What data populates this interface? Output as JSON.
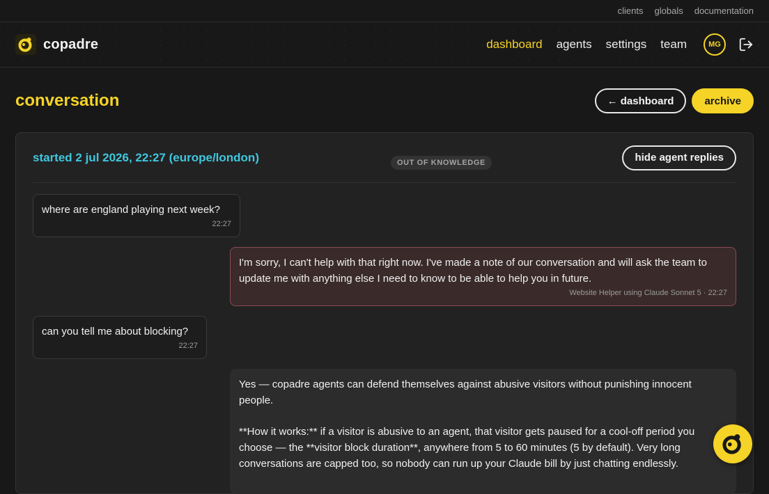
{
  "topbar": {
    "links": [
      "clients",
      "globals",
      "documentation"
    ]
  },
  "brand": {
    "name": "copadre",
    "accent": "#f5d327"
  },
  "nav": {
    "items": [
      {
        "label": "dashboard",
        "active": true
      },
      {
        "label": "agents",
        "active": false
      },
      {
        "label": "settings",
        "active": false
      },
      {
        "label": "team",
        "active": false
      }
    ],
    "avatar_initials": "MG",
    "logout_icon": "logout-icon"
  },
  "page": {
    "title": "conversation",
    "back_label": "← dashboard",
    "archive_label": "archive"
  },
  "conversation": {
    "started": "started 2 jul 2026, 22:27 (europe/london)",
    "status_badge": "OUT OF KNOWLEDGE",
    "hide_replies_label": "hide agent replies",
    "messages": [
      {
        "role": "user",
        "text": "where are england playing next week?",
        "time": "22:27"
      },
      {
        "role": "agent",
        "text": "I'm sorry, I can't help with that right now. I've made a note of our conversation and will ask the team to update me with anything else I need to know to be able to help you in future.",
        "meta": "Website Helper using Claude Sonnet 5 · 22:27"
      },
      {
        "role": "user",
        "text": "can you tell me about blocking?",
        "time": "22:27"
      },
      {
        "role": "agent",
        "paragraphs": [
          "Yes — copadre agents can defend themselves against abusive visitors without punishing innocent people.",
          "**How it works:** if a visitor is abusive to an agent, that visitor gets paused for a cool-off period you choose — the **visitor block duration**, anywhere from 5 to 60 minutes (5 by default). Very long conversations are capped too, so nobody can run up your Claude bill by just chatting endlessly."
        ]
      }
    ]
  },
  "colors": {
    "background": "#181818",
    "accent_yellow": "#f5d327",
    "accent_cyan": "#3fc7df",
    "oof_bubble": "#3a2a2a",
    "oof_border": "#8a4a55"
  }
}
